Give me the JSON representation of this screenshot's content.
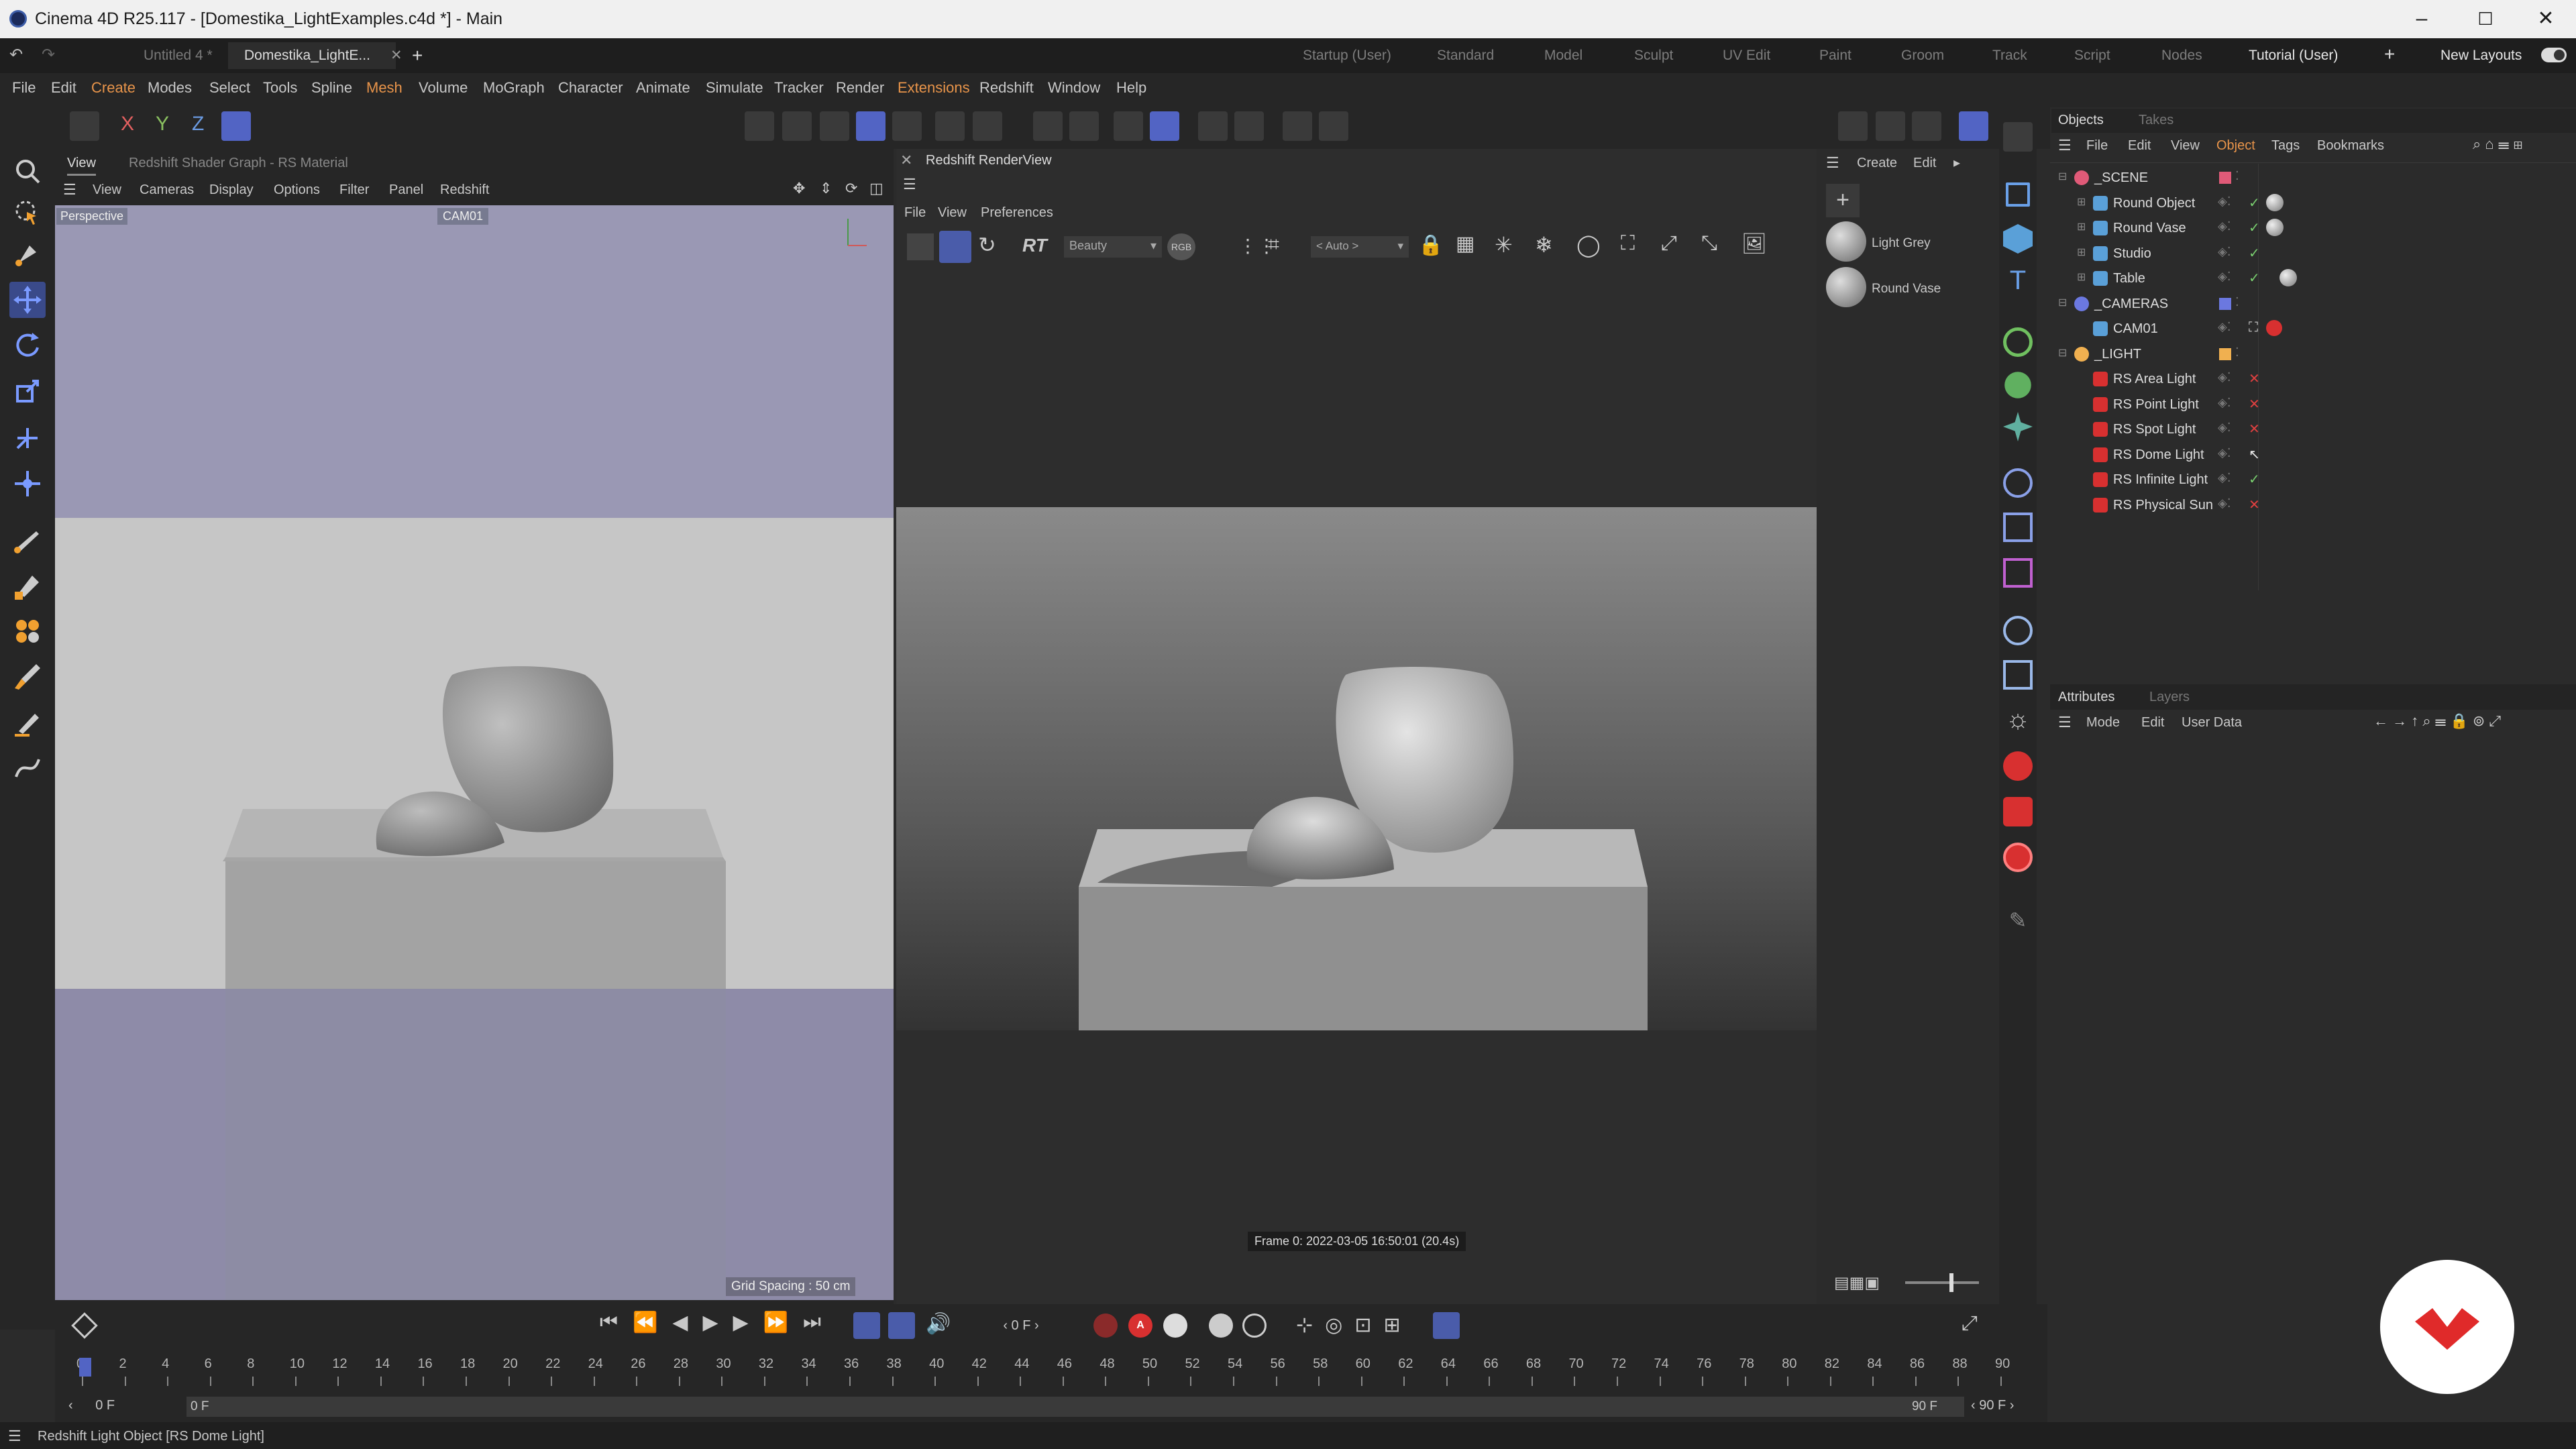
{
  "window": {
    "title": "Cinema 4D R25.117 - [Domestika_LightExamples.c4d *] - Main"
  },
  "tabs": {
    "untitled": "Untitled 4 *",
    "main": "Domestika_LightE..."
  },
  "layouts": [
    "Startup (User)",
    "Standard",
    "Model",
    "Sculpt",
    "UV Edit",
    "Paint",
    "Groom",
    "Track",
    "Script",
    "Nodes",
    "Tutorial (User)"
  ],
  "new_layouts": "New Layouts",
  "menu": [
    "File",
    "Edit",
    "Create",
    "Modes",
    "Select",
    "Tools",
    "Spline",
    "Mesh",
    "Volume",
    "MoGraph",
    "Character",
    "Animate",
    "Simulate",
    "Tracker",
    "Render",
    "Extensions",
    "Redshift",
    "Window",
    "Help"
  ],
  "axis": {
    "x": "X",
    "y": "Y",
    "z": "Z"
  },
  "viewport": {
    "tab_view": "View",
    "tab_shader": "Redshift Shader Graph - RS Material",
    "menu": [
      "View",
      "Cameras",
      "Display",
      "Options",
      "Filter",
      "Panel",
      "Redshift"
    ],
    "label": "Perspective",
    "camera": "CAM01",
    "grid": "Grid Spacing : 50 cm"
  },
  "renderview": {
    "title": "Redshift RenderView",
    "menu": [
      "File",
      "View",
      "Preferences"
    ],
    "aov": "Beauty",
    "color": "RGB",
    "auto": "< Auto >",
    "rt": "RT",
    "frame_info": "Frame 0:  2022-03-05  16:50:01  (20.4s)"
  },
  "materials": {
    "menu": [
      "Create",
      "Edit"
    ],
    "items": [
      "Light Grey",
      "Round Vase"
    ]
  },
  "objects": {
    "tabs": [
      "Objects",
      "Takes"
    ],
    "menu": [
      "File",
      "Edit",
      "View",
      "Object",
      "Tags",
      "Bookmarks"
    ],
    "rows": [
      {
        "name": "_SCENE",
        "color": "#e05a78"
      },
      {
        "name": "Round Object",
        "color": ""
      },
      {
        "name": "Round Vase",
        "color": ""
      },
      {
        "name": "Studio",
        "color": ""
      },
      {
        "name": "Table",
        "color": ""
      },
      {
        "name": "_CAMERAS",
        "color": "#6b78e0"
      },
      {
        "name": "CAM01",
        "color": ""
      },
      {
        "name": "_LIGHT",
        "color": "#f0b050"
      },
      {
        "name": "RS Area Light",
        "color": ""
      },
      {
        "name": "RS Point Light",
        "color": ""
      },
      {
        "name": "RS Spot Light",
        "color": ""
      },
      {
        "name": "RS Dome Light",
        "color": ""
      },
      {
        "name": "RS Infinite Light",
        "color": ""
      },
      {
        "name": "RS Physical Sun",
        "color": ""
      }
    ]
  },
  "attributes": {
    "tabs": [
      "Attributes",
      "Layers"
    ],
    "menu": [
      "Mode",
      "Edit",
      "User Data"
    ]
  },
  "timeline": {
    "current_frame": "0 F",
    "ticks": [
      "0",
      "2",
      "4",
      "6",
      "8",
      "10",
      "12",
      "14",
      "16",
      "18",
      "20",
      "22",
      "24",
      "26",
      "28",
      "30",
      "32",
      "34",
      "36",
      "38",
      "40",
      "42",
      "44",
      "46",
      "48",
      "50",
      "52",
      "54",
      "56",
      "58",
      "60",
      "62",
      "64",
      "66",
      "68",
      "70",
      "72",
      "74",
      "76",
      "78",
      "80",
      "82",
      "84",
      "86",
      "88",
      "90"
    ],
    "start": "0 F",
    "start2": "0 F",
    "end": "90 F",
    "end2": "90 F"
  },
  "status": "Redshift Light Object [RS Dome Light]"
}
